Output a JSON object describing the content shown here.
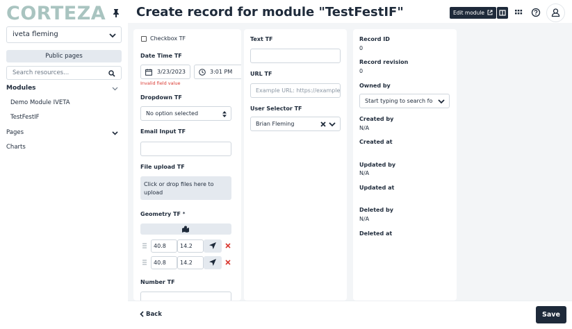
{
  "sidebar": {
    "logo": "CORTEZA",
    "user": "iveta fleming",
    "public_pages": "Public pages",
    "search_placeholder": "Search resources...",
    "modules_heading": "Modules",
    "modules": [
      "Demo Module IVETA",
      "TestFestIF"
    ],
    "pages_heading": "Pages",
    "charts_heading": "Charts"
  },
  "header": {
    "title": "Create record for module \"TestFestIF\"",
    "edit_module": "Edit module"
  },
  "form": {
    "checkbox_label": "Checkbox TF",
    "datetime_label": "Date Time TF",
    "date_value": "3/23/2023",
    "time_value": "3:01 PM",
    "datetime_error": "Invalid field value",
    "dropdown_label": "Dropdown TF",
    "dropdown_value": "No option selected",
    "email_label": "Email Input TF",
    "file_label": "File upload TF",
    "file_hint": "Click or drop files here to upload",
    "geometry_label": "Geometry TF",
    "geometry_required": "*",
    "geometry_rows": [
      {
        "lat": "40.8",
        "lng": "14.2"
      },
      {
        "lat": "40.8",
        "lng": "14.2"
      }
    ],
    "number_label": "Number TF",
    "text_label": "Text TF",
    "url_label": "URL TF",
    "url_placeholder": "Example URL: https://example.com",
    "user_selector_label": "User Selector TF",
    "user_selector_value": "Brian Fleming"
  },
  "meta": {
    "record_id_label": "Record ID",
    "record_id": "0",
    "revision_label": "Record revision",
    "revision": "0",
    "owned_by_label": "Owned by",
    "owned_by_placeholder": "Start typing to search for users",
    "created_by_label": "Created by",
    "created_by": "N/A",
    "created_at_label": "Created at",
    "updated_by_label": "Updated by",
    "updated_by": "N/A",
    "updated_at_label": "Updated at",
    "deleted_by_label": "Deleted by",
    "deleted_by": "N/A",
    "deleted_at_label": "Deleted at"
  },
  "footer": {
    "back": "Back",
    "save": "Save"
  },
  "colors": {
    "primary": "#1e2a3a",
    "logo": "#a9c4c0",
    "error": "#d9362e",
    "panel_bg": "#f3f5f7"
  }
}
